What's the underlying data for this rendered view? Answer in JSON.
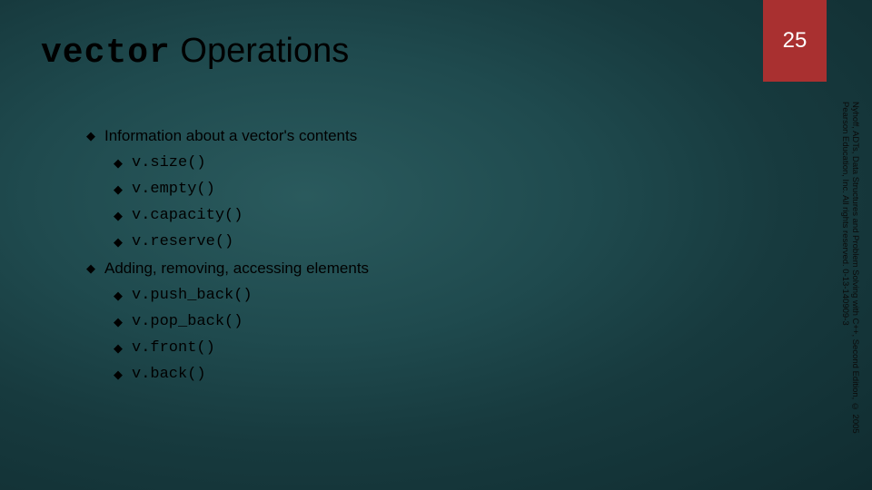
{
  "page_number": "25",
  "title_mono": "vector",
  "title_rest": " Operations",
  "bullets": [
    {
      "level": 1,
      "text": "Information about a vector's contents",
      "mono": false
    },
    {
      "level": 2,
      "text": "v.size()",
      "mono": true
    },
    {
      "level": 2,
      "text": "v.empty()",
      "mono": true
    },
    {
      "level": 2,
      "text": "v.capacity()",
      "mono": true
    },
    {
      "level": 2,
      "text": "v.reserve()",
      "mono": true
    },
    {
      "level": 1,
      "text": "Adding, removing, accessing elements",
      "mono": false
    },
    {
      "level": 2,
      "text": "v.push_back()",
      "mono": true
    },
    {
      "level": 2,
      "text": "v.pop_back()",
      "mono": true
    },
    {
      "level": 2,
      "text": "v.front()",
      "mono": true
    },
    {
      "level": 2,
      "text": "v.back()",
      "mono": true
    }
  ],
  "attribution": "Nyhoff, ADTs, Data Structures and Problem Solving with C++, Second Edition, © 2005 Pearson Education, Inc. All rights reserved. 0-13-140909-3",
  "bullet_glyph": "◆"
}
